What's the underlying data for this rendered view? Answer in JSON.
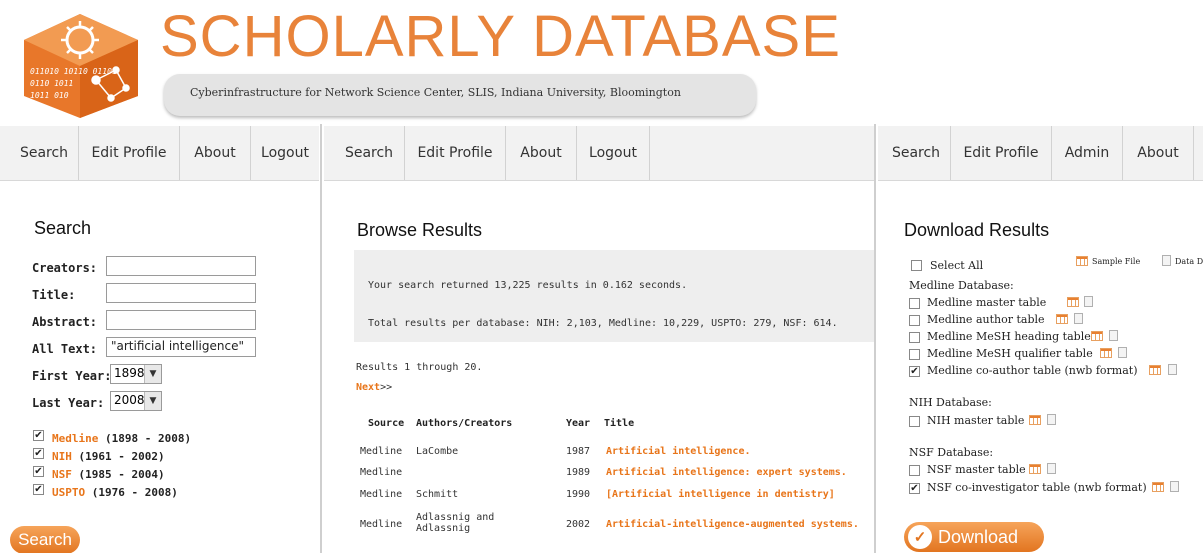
{
  "header": {
    "title": "SCHOLARLY DATABASE",
    "subtitle": "Cyberinfrastructure for Network Science Center, SLIS, Indiana University, Bloomington",
    "logo_text": "011010 10110 01101"
  },
  "left_panel": {
    "nav": [
      "Search",
      "Edit Profile",
      "About",
      "Logout"
    ],
    "heading": "Search",
    "fields": {
      "creators_label": "Creators:",
      "title_label": "Title:",
      "abstract_label": "Abstract:",
      "alltext_label": "All Text:",
      "alltext_value": "\"artificial intelligence\"",
      "first_year_label": "First Year:",
      "first_year_value": "1898",
      "last_year_label": "Last Year:",
      "last_year_value": "2008"
    },
    "databases": [
      {
        "name": "Medline",
        "range": "(1898 - 2008)",
        "checked": true
      },
      {
        "name": "NIH",
        "range": "(1961 - 2002)",
        "checked": true
      },
      {
        "name": "NSF",
        "range": "(1985 - 2004)",
        "checked": true
      },
      {
        "name": "USPTO",
        "range": "(1976 - 2008)",
        "checked": true
      }
    ],
    "search_button": "Search"
  },
  "middle_panel": {
    "nav": [
      "Search",
      "Edit Profile",
      "About",
      "Logout"
    ],
    "heading": "Browse Results",
    "summary": "Your search returned 13,225 results in 0.162 seconds.",
    "per_db": "Total results per database: NIH: 2,103, Medline: 10,229, USPTO: 279, NSF: 614.",
    "range_text": "Results 1 through 20.",
    "next_link": "Next",
    "next_suffix": ">>",
    "columns": [
      "Source",
      "Authors/Creators",
      "Year",
      "Title"
    ],
    "rows": [
      {
        "source": "Medline",
        "authors": "LaCombe",
        "year": "1987",
        "title": "Artificial intelligence."
      },
      {
        "source": "Medline",
        "authors": "",
        "year": "1989",
        "title": "Artificial intelligence: expert systems."
      },
      {
        "source": "Medline",
        "authors": "Schmitt",
        "year": "1990",
        "title": "[Artificial intelligence in dentistry]"
      },
      {
        "source": "Medline",
        "authors": "Adlassnig and Adlassnig",
        "year": "2002",
        "title": "Artificial-intelligence-augmented systems."
      }
    ]
  },
  "right_panel": {
    "nav": [
      "Search",
      "Edit Profile",
      "Admin",
      "About"
    ],
    "heading": "Download Results",
    "select_all": "Select All",
    "sample_file": "Sample File",
    "data_dictionary": "Data Dictiona",
    "groups": [
      {
        "title": "Medline Database:",
        "items": [
          {
            "label": "Medline master table",
            "checked": false
          },
          {
            "label": "Medline author table",
            "checked": false
          },
          {
            "label": "Medline MeSH heading table",
            "checked": false
          },
          {
            "label": "Medline MeSH qualifier table",
            "checked": false
          },
          {
            "label": "Medline co-author table (nwb format)",
            "checked": true
          }
        ]
      },
      {
        "title": "NIH Database:",
        "items": [
          {
            "label": "NIH master table",
            "checked": false
          }
        ]
      },
      {
        "title": "NSF Database:",
        "items": [
          {
            "label": "NSF master table",
            "checked": false
          },
          {
            "label": "NSF co-investigator table (nwb format)",
            "checked": true
          }
        ]
      }
    ],
    "download_button": "Download"
  },
  "colors": {
    "accent": "#e8751a",
    "title": "#e8833a"
  }
}
